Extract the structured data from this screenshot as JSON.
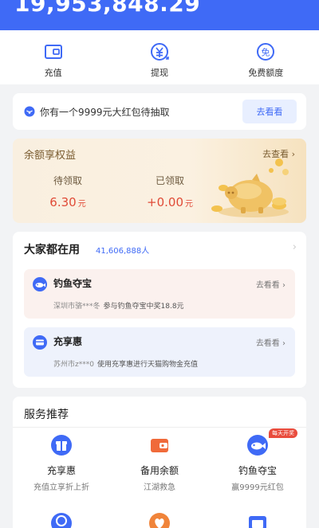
{
  "balance": "19,953,848.29",
  "actions": [
    {
      "label": "充值",
      "icon": "wallet-icon"
    },
    {
      "label": "提现",
      "icon": "yuan-withdraw-icon"
    },
    {
      "label": "免费额度",
      "icon": "free-quota-icon"
    }
  ],
  "red_packet": {
    "text": "你有一个9999元大红包待抽取",
    "button": "去看看"
  },
  "perk": {
    "title": "余额享权益",
    "more": "去查看",
    "pending_label": "待领取",
    "pending_value": "6.30",
    "received_label": "已领取",
    "received_value": "+0.00",
    "unit": "元"
  },
  "popular": {
    "title": "大家都在用",
    "count": "41,606,888人",
    "items": [
      {
        "name": "钓鱼夺宝",
        "go": "去看看",
        "user": "深圳市骆***冬",
        "desc": "参与钓鱼夺宝中奖18.8元"
      },
      {
        "name": "充享惠",
        "go": "去看看",
        "user": "苏州市z***0",
        "desc": "使用充享惠进行天猫购物金充值"
      }
    ]
  },
  "services": {
    "title": "服务推荐",
    "items": [
      {
        "name": "充享惠",
        "sub": "充值立享折上折"
      },
      {
        "name": "备用余额",
        "sub": "江湖救急"
      },
      {
        "name": "钓鱼夺宝",
        "sub": "赢9999元红包",
        "badge": "每天开奖"
      }
    ]
  },
  "colors": {
    "primary": "#3f6af6",
    "red": "#e04b37",
    "gold": "#f3c24e"
  }
}
